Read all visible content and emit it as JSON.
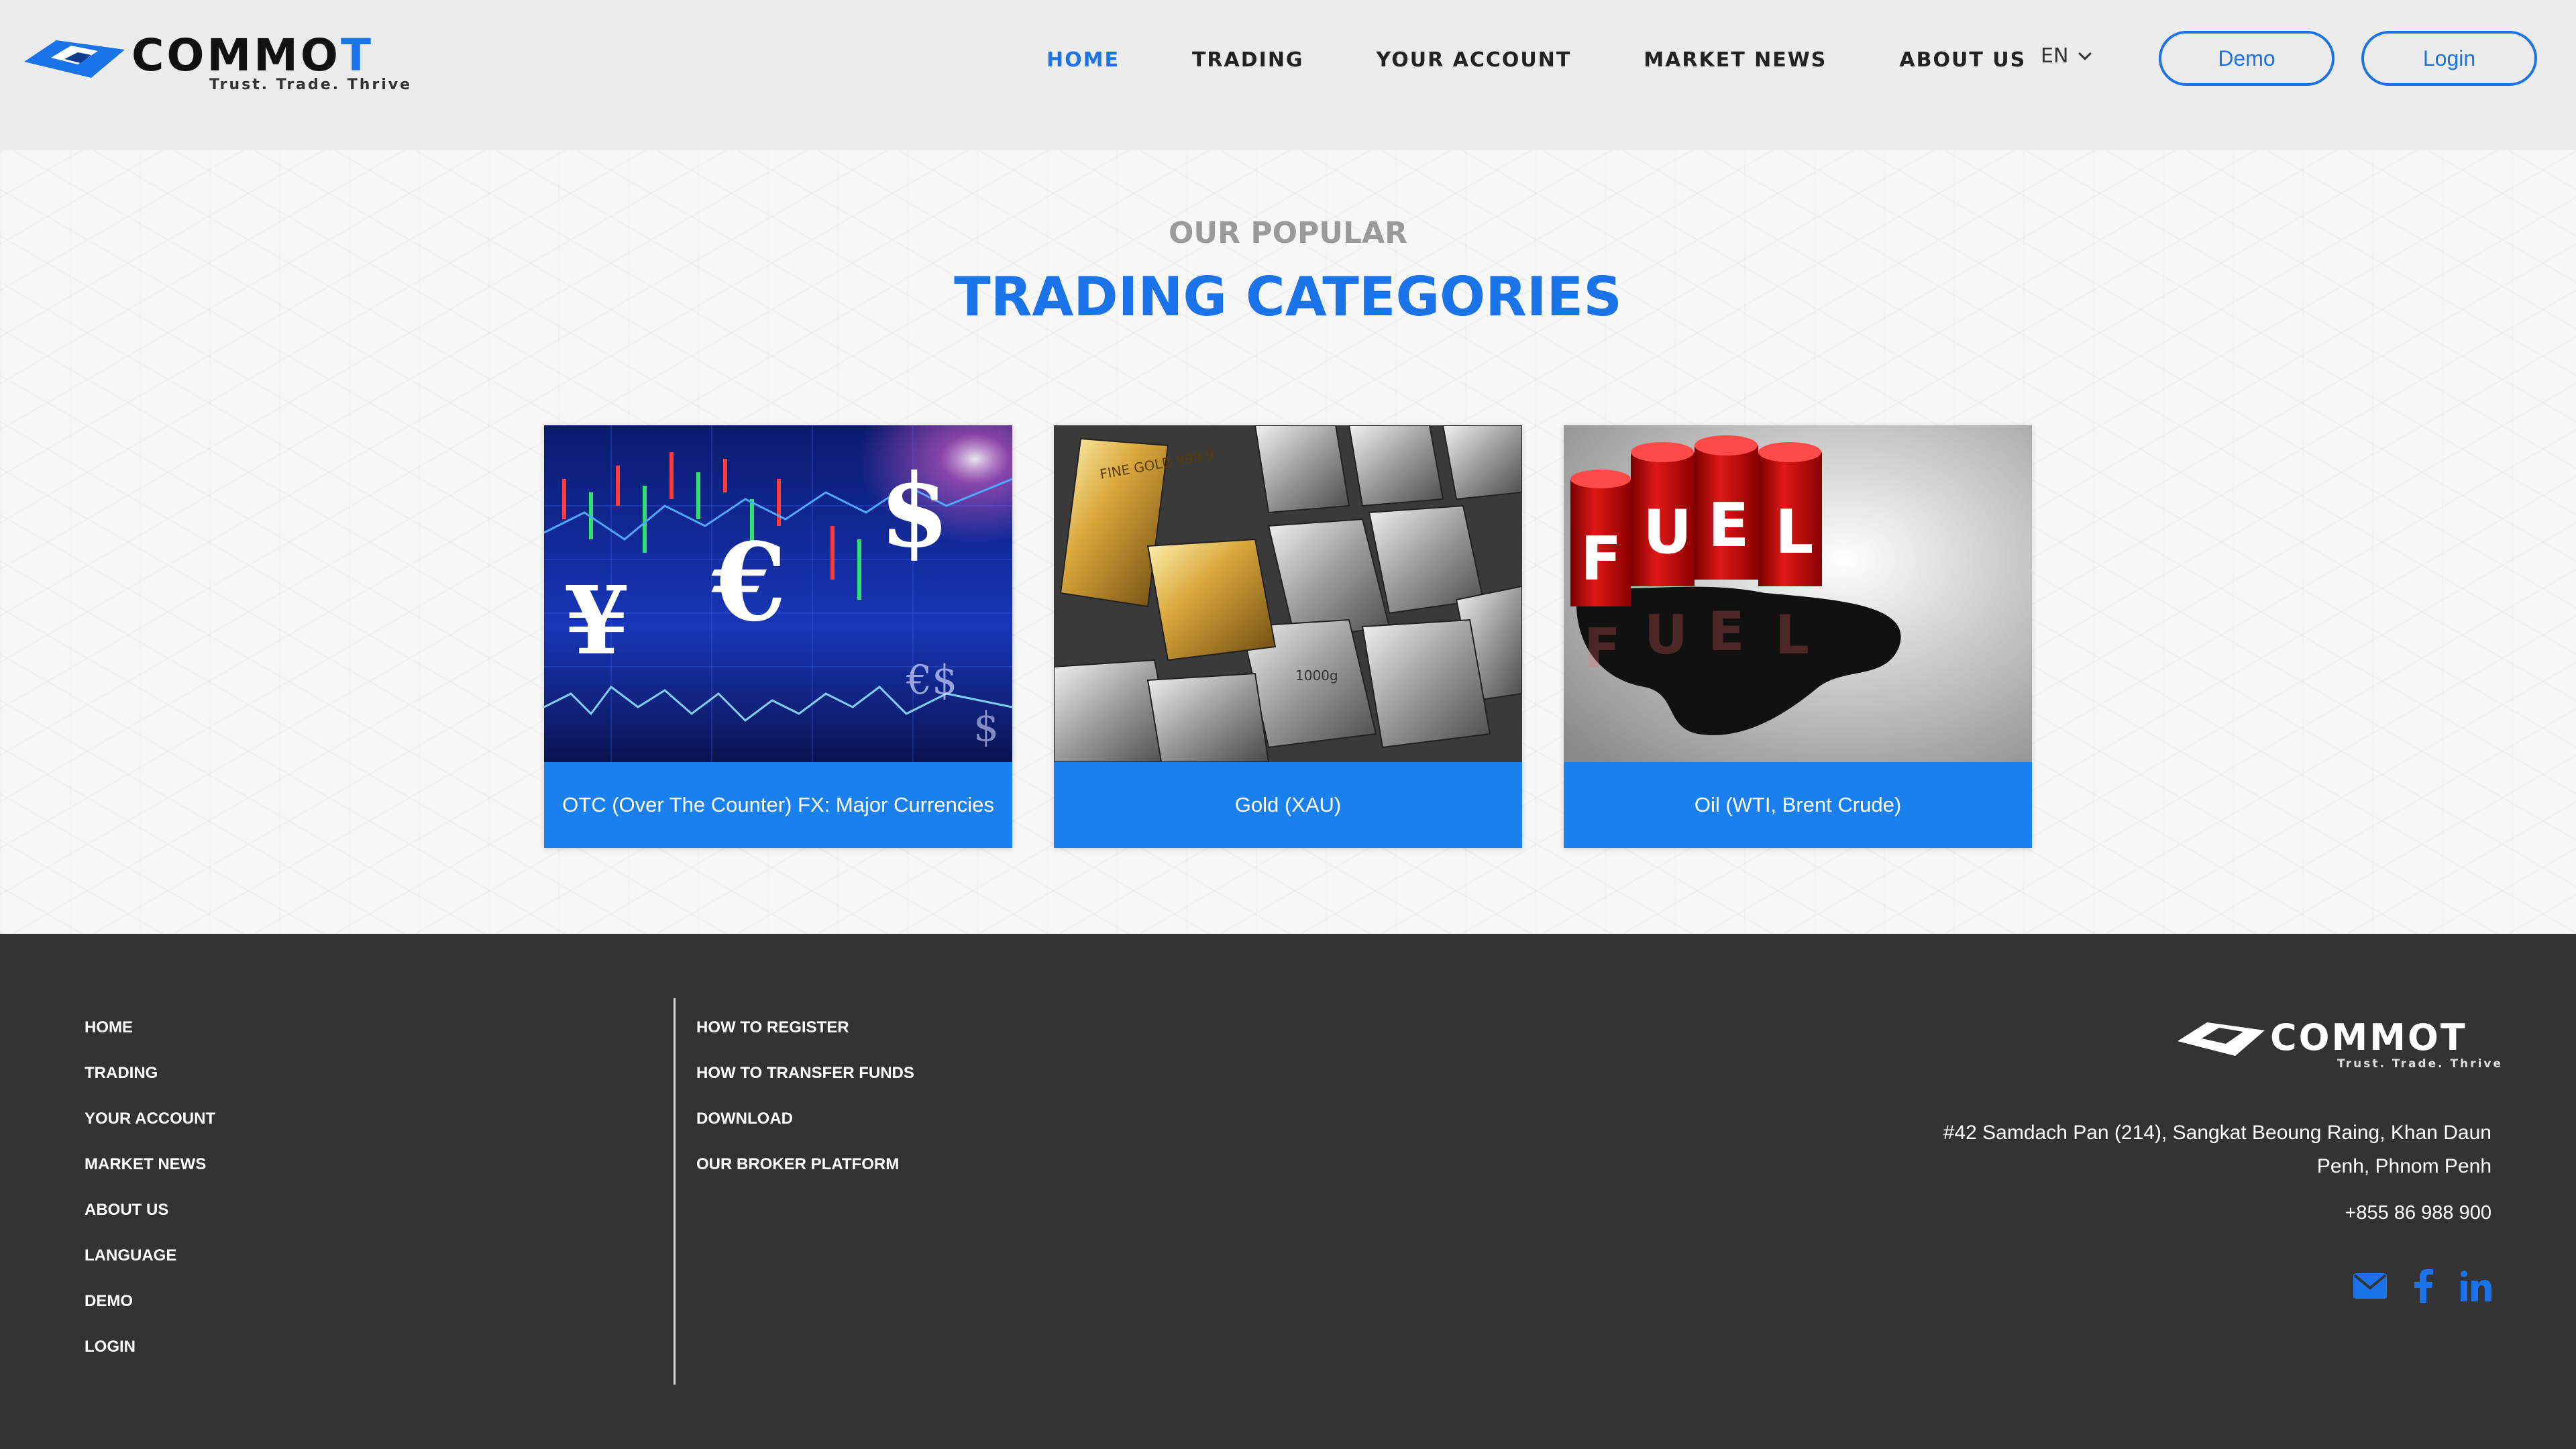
{
  "header": {
    "logo_text_main": "COMMO",
    "logo_text_accent": "T",
    "logo_tagline": "Trust. Trade. Thrive",
    "nav": [
      {
        "label": "HOME"
      },
      {
        "label": "TRADING"
      },
      {
        "label": "YOUR ACCOUNT"
      },
      {
        "label": "MARKET NEWS"
      },
      {
        "label": "ABOUT US"
      }
    ],
    "active_nav": "HOME",
    "language": "EN",
    "demo_label": "Demo",
    "login_label": "Login"
  },
  "section": {
    "subtitle": "OUR POPULAR",
    "title": "TRADING CATEGORIES",
    "cards": [
      {
        "label": "OTC (Over The Counter) FX: Major Currencies",
        "image": "currency-chart"
      },
      {
        "label": "Gold (XAU)",
        "image": "gold-silver-bars"
      },
      {
        "label": "Oil (WTI, Brent Crude)",
        "image": "fuel-barrels"
      }
    ]
  },
  "footer": {
    "col1": [
      {
        "label": "HOME"
      },
      {
        "label": "TRADING"
      },
      {
        "label": "YOUR ACCOUNT"
      },
      {
        "label": "MARKET NEWS"
      },
      {
        "label": "ABOUT US"
      },
      {
        "label": "LANGUAGE"
      },
      {
        "label": "DEMO"
      },
      {
        "label": "LOGIN"
      }
    ],
    "col2": [
      {
        "label": "HOW TO REGISTER"
      },
      {
        "label": "HOW TO TRANSFER FUNDS"
      },
      {
        "label": "DOWNLOAD"
      },
      {
        "label": "OUR BROKER PLATFORM"
      }
    ],
    "logo_text_main": "COMMO",
    "logo_text_accent": "T",
    "logo_tagline": "Trust. Trade. Thrive",
    "address_line1": "#42 Samdach Pan (214), Sangkat Beoung Raing, Khan Daun",
    "address_line2": "Penh, Phnom Penh",
    "phone": "+855 86 988 900",
    "social_icons": [
      "envelope-icon",
      "facebook-icon",
      "linkedin-icon"
    ]
  },
  "colors": {
    "accent": "#1a73e8",
    "card_label_bg": "#1a80ee",
    "header_bg": "#ececec",
    "footer_bg": "#333333"
  }
}
